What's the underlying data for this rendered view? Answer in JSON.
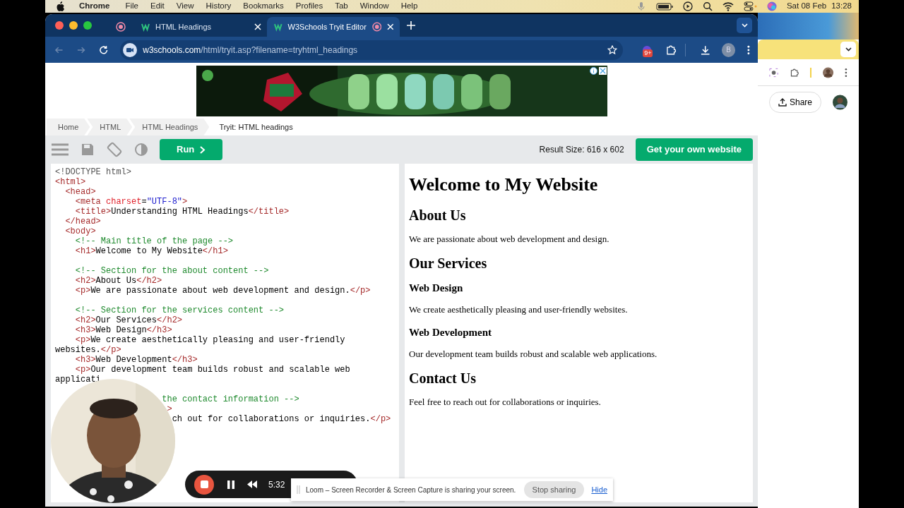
{
  "menubar": {
    "app": "Chrome",
    "menus": [
      "File",
      "Edit",
      "View",
      "History",
      "Bookmarks",
      "Profiles",
      "Tab",
      "Window",
      "Help"
    ],
    "date": "Sat 08 Feb",
    "time": "13:28"
  },
  "tabs": [
    {
      "kind": "pinned",
      "selected": false,
      "recording": true
    },
    {
      "kind": "page",
      "title": "HTML Headings",
      "selected": false,
      "recording": false
    },
    {
      "kind": "page",
      "title": "W3Schools Tryit Editor",
      "selected": true,
      "recording": true
    }
  ],
  "address_bar": {
    "host": "w3schools.com",
    "path": "/html/tryit.asp?filename=tryhtml_headings"
  },
  "extension_badge": "9+",
  "profile_initial": "B",
  "breadcrumbs": [
    {
      "label": "Home",
      "current": false
    },
    {
      "label": "HTML",
      "current": false
    },
    {
      "label": "HTML Headings",
      "current": false
    },
    {
      "label": "Tryit: HTML headings",
      "current": true
    }
  ],
  "toolbar": {
    "run_label": "Run",
    "result_size": "Result Size: 616 x 602",
    "cta": "Get your own website"
  },
  "code_lines": [
    {
      "kind": "code",
      "segments": [
        {
          "kind": "doctype",
          "text": "<!DOCTYPE html>"
        }
      ]
    },
    {
      "kind": "code",
      "segments": [
        {
          "kind": "tag",
          "text": "<html>"
        }
      ]
    },
    {
      "kind": "code",
      "segments": [
        {
          "kind": "tag",
          "text": "  <head>"
        }
      ]
    },
    {
      "kind": "code",
      "segments": [
        {
          "kind": "tag",
          "text": "    <meta"
        },
        {
          "kind": "attr",
          "text": " charset"
        },
        {
          "kind": "text",
          "text": "="
        },
        {
          "kind": "string",
          "text": "\"UTF-8\""
        },
        {
          "kind": "tag",
          "text": ">"
        }
      ]
    },
    {
      "kind": "code",
      "segments": [
        {
          "kind": "tag",
          "text": "    <title>"
        },
        {
          "kind": "text",
          "text": "Understanding HTML Headings"
        },
        {
          "kind": "tag",
          "text": "</title>"
        }
      ]
    },
    {
      "kind": "code",
      "segments": [
        {
          "kind": "tag",
          "text": "  </head>"
        }
      ]
    },
    {
      "kind": "code",
      "segments": [
        {
          "kind": "tag",
          "text": "  <body>"
        }
      ]
    },
    {
      "kind": "code",
      "segments": [
        {
          "kind": "comment",
          "text": "    <!-- Main title of the page -->"
        }
      ]
    },
    {
      "kind": "code",
      "segments": [
        {
          "kind": "tag",
          "text": "    <h1>"
        },
        {
          "kind": "text",
          "text": "Welcome to My Website"
        },
        {
          "kind": "tag",
          "text": "</h1>"
        }
      ]
    },
    {
      "kind": "blank"
    },
    {
      "kind": "code",
      "segments": [
        {
          "kind": "comment",
          "text": "    <!-- Section for the about content -->"
        }
      ]
    },
    {
      "kind": "code",
      "segments": [
        {
          "kind": "tag",
          "text": "    <h2>"
        },
        {
          "kind": "text",
          "text": "About Us"
        },
        {
          "kind": "tag",
          "text": "</h2>"
        }
      ]
    },
    {
      "kind": "code",
      "segments": [
        {
          "kind": "tag",
          "text": "    <p>"
        },
        {
          "kind": "text",
          "text": "We are passionate about web development and design."
        },
        {
          "kind": "tag",
          "text": "</p>"
        }
      ]
    },
    {
      "kind": "blank"
    },
    {
      "kind": "code",
      "segments": [
        {
          "kind": "comment",
          "text": "    <!-- Section for the services content -->"
        }
      ]
    },
    {
      "kind": "code",
      "segments": [
        {
          "kind": "tag",
          "text": "    <h2>"
        },
        {
          "kind": "text",
          "text": "Our Services"
        },
        {
          "kind": "tag",
          "text": "</h2>"
        }
      ]
    },
    {
      "kind": "code",
      "segments": [
        {
          "kind": "tag",
          "text": "    <h3>"
        },
        {
          "kind": "text",
          "text": "Web Design"
        },
        {
          "kind": "tag",
          "text": "</h3>"
        }
      ]
    },
    {
      "kind": "code",
      "segments": [
        {
          "kind": "tag",
          "text": "    <p>"
        },
        {
          "kind": "text",
          "text": "We create aesthetically pleasing and user-friendly"
        }
      ]
    },
    {
      "kind": "code",
      "segments": [
        {
          "kind": "text",
          "text": "websites."
        },
        {
          "kind": "tag",
          "text": "</p>"
        }
      ]
    },
    {
      "kind": "code",
      "segments": [
        {
          "kind": "tag",
          "text": "    <h3>"
        },
        {
          "kind": "text",
          "text": "Web Development"
        },
        {
          "kind": "tag",
          "text": "</h3>"
        }
      ]
    },
    {
      "kind": "code",
      "segments": [
        {
          "kind": "tag",
          "text": "    <p>"
        },
        {
          "kind": "text",
          "text": "Our development team builds robust and scalable web"
        }
      ]
    },
    {
      "kind": "code",
      "segments": [
        {
          "kind": "text",
          "text": "applicati"
        }
      ]
    },
    {
      "kind": "blank"
    },
    {
      "kind": "code",
      "segments": [
        {
          "kind": "comment",
          "text": "                     the contact information -->"
        }
      ]
    },
    {
      "kind": "code",
      "segments": [
        {
          "kind": "tag",
          "text": "                      >"
        }
      ]
    },
    {
      "kind": "code",
      "segments": [
        {
          "kind": "text",
          "text": "                       ch out for collaborations or inquiries."
        },
        {
          "kind": "tag",
          "text": "</p>"
        }
      ]
    }
  ],
  "result": [
    {
      "kind": "h1",
      "text": "Welcome to My Website"
    },
    {
      "kind": "h2",
      "text": "About Us"
    },
    {
      "kind": "p",
      "text": "We are passionate about web development and design."
    },
    {
      "kind": "h2",
      "text": "Our Services"
    },
    {
      "kind": "h3",
      "text": "Web Design"
    },
    {
      "kind": "p",
      "text": "We create aesthetically pleasing and user-friendly websites."
    },
    {
      "kind": "h3",
      "text": "Web Development"
    },
    {
      "kind": "p",
      "text": "Our development team builds robust and scalable web applications."
    },
    {
      "kind": "h2",
      "text": "Contact Us"
    },
    {
      "kind": "p",
      "text": "Feel free to reach out for collaborations or inquiries."
    }
  ],
  "recorder": {
    "time": "5:32"
  },
  "share_notice": {
    "message": "Loom – Screen Recorder & Screen Capture is sharing your screen.",
    "stop": "Stop sharing",
    "hide": "Hide"
  },
  "background_window": {
    "share": "Share"
  }
}
